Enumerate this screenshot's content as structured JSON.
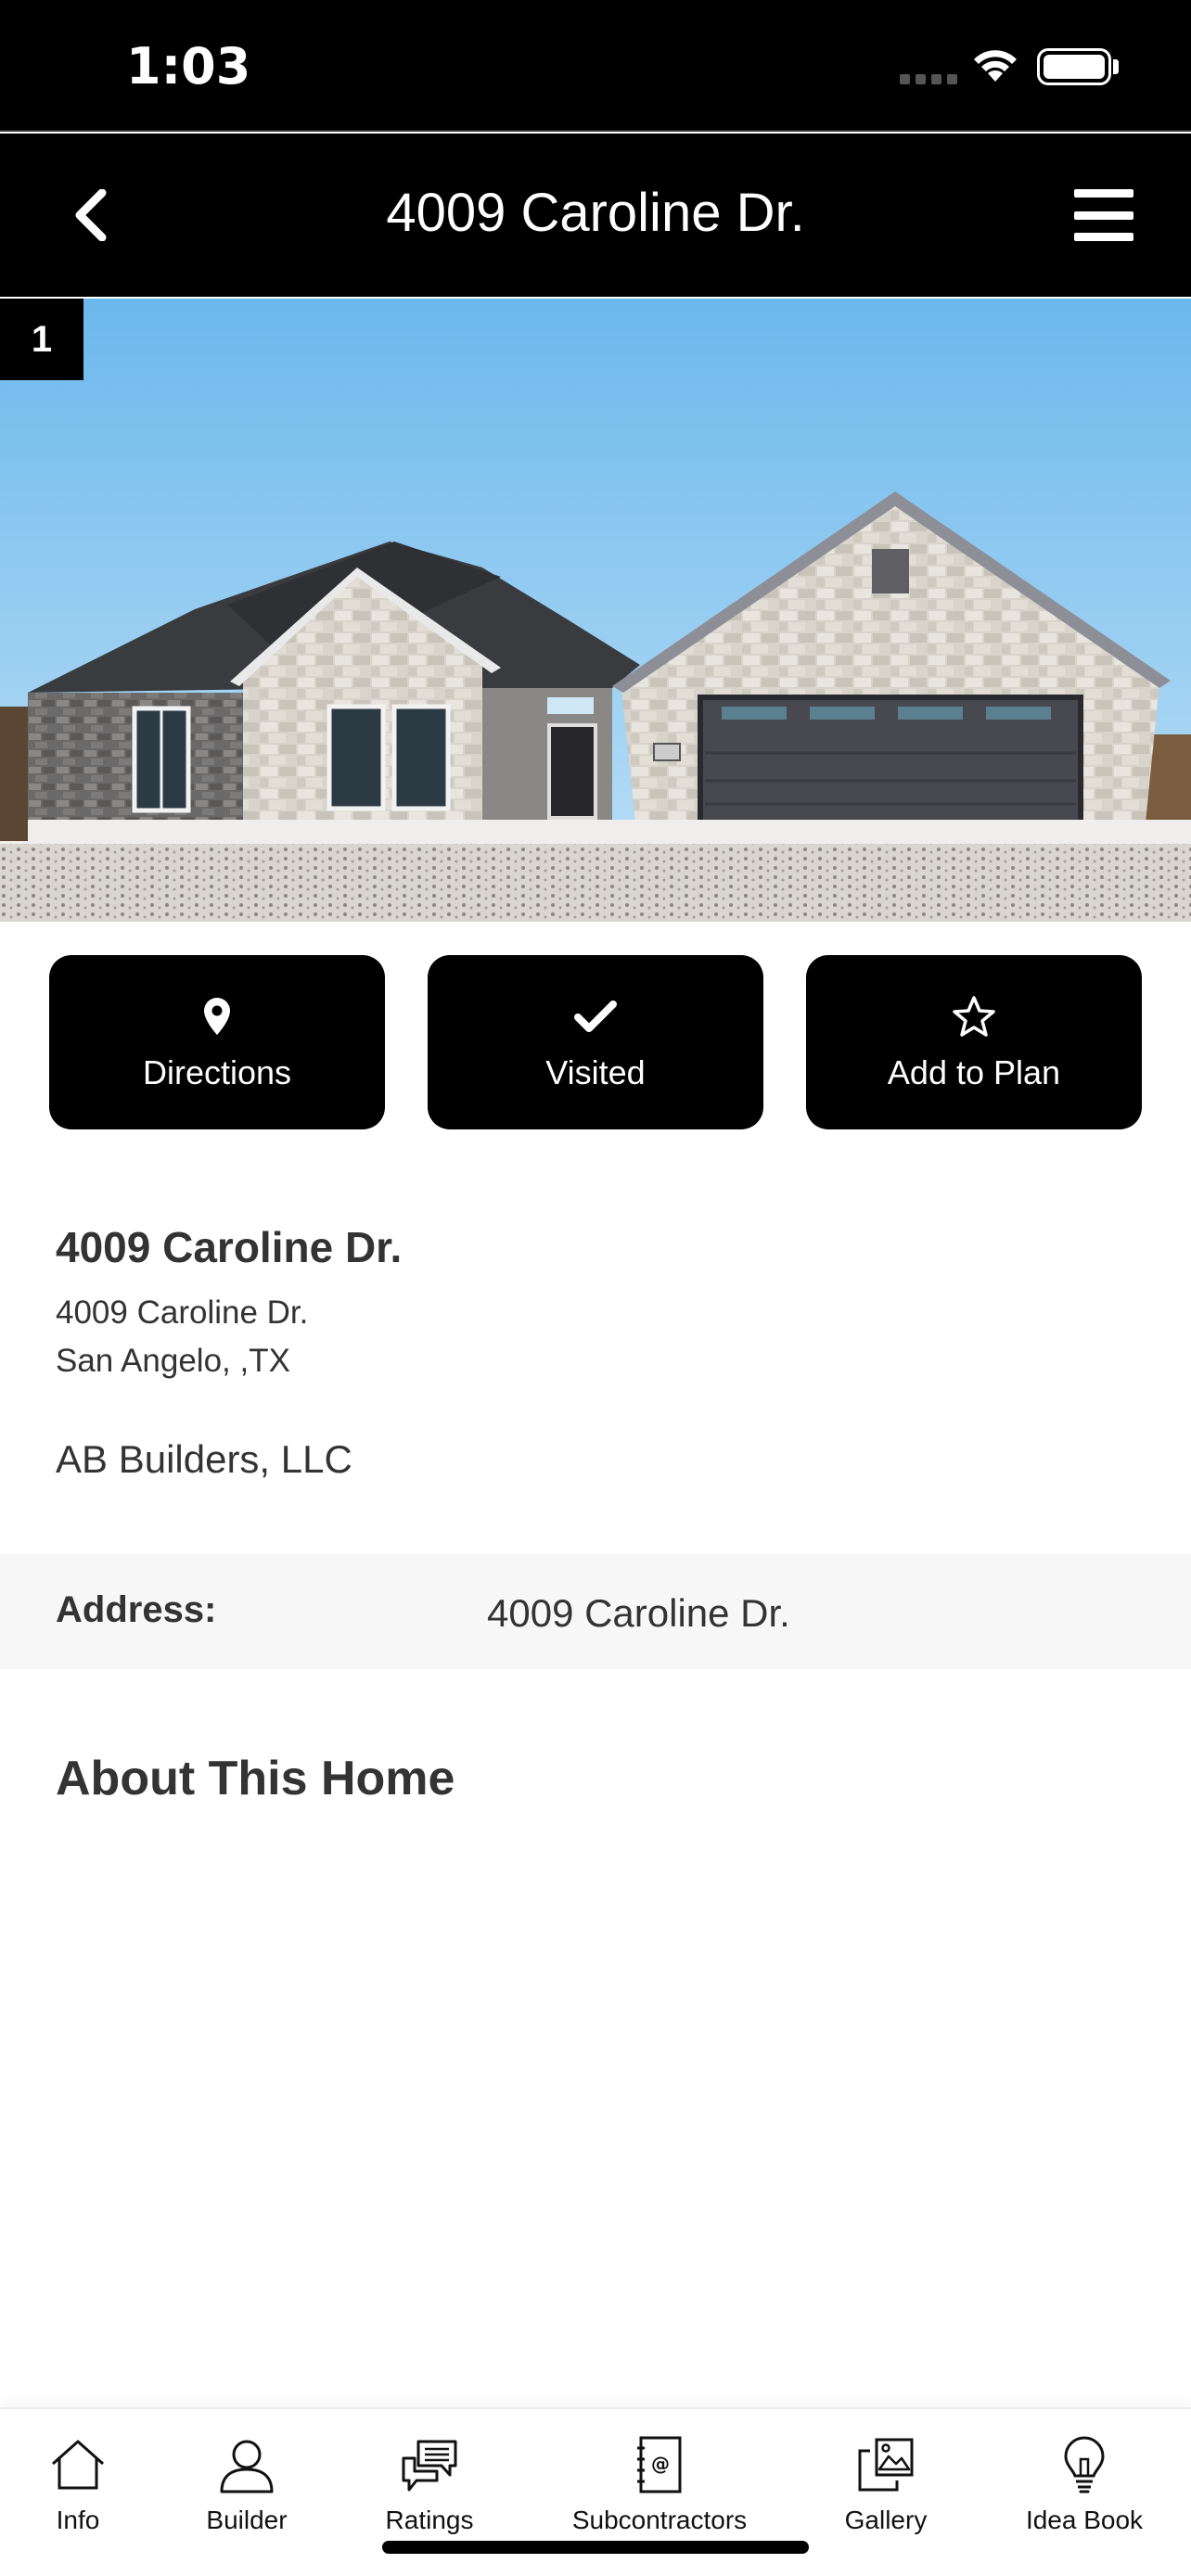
{
  "status_bar": {
    "time": "1:03"
  },
  "nav": {
    "title": "4009 Caroline Dr."
  },
  "hero": {
    "photo_index": "1"
  },
  "actions": [
    {
      "label": "Directions",
      "icon": "map-pin-icon"
    },
    {
      "label": "Visited",
      "icon": "checkmark-icon"
    },
    {
      "label": "Add to Plan",
      "icon": "star-icon"
    }
  ],
  "details": {
    "title": "4009 Caroline Dr.",
    "address_line1": "4009 Caroline Dr.",
    "address_line2": "San Angelo, ,TX",
    "builder": "AB Builders, LLC"
  },
  "address_row": {
    "label": "Address:",
    "value": "4009 Caroline Dr."
  },
  "about": {
    "title": "About This Home"
  },
  "tabs": [
    {
      "label": "Info",
      "icon": "home-icon"
    },
    {
      "label": "Builder",
      "icon": "person-icon"
    },
    {
      "label": "Ratings",
      "icon": "chat-bubbles-icon"
    },
    {
      "label": "Subcontractors",
      "icon": "address-book-icon"
    },
    {
      "label": "Gallery",
      "icon": "images-icon"
    },
    {
      "label": "Idea Book",
      "icon": "lightbulb-icon"
    }
  ],
  "colors": {
    "bar_bg": "#000000",
    "text": "#333333",
    "row_bg": "#f7f7f7",
    "sky": "#7fc3ee"
  }
}
